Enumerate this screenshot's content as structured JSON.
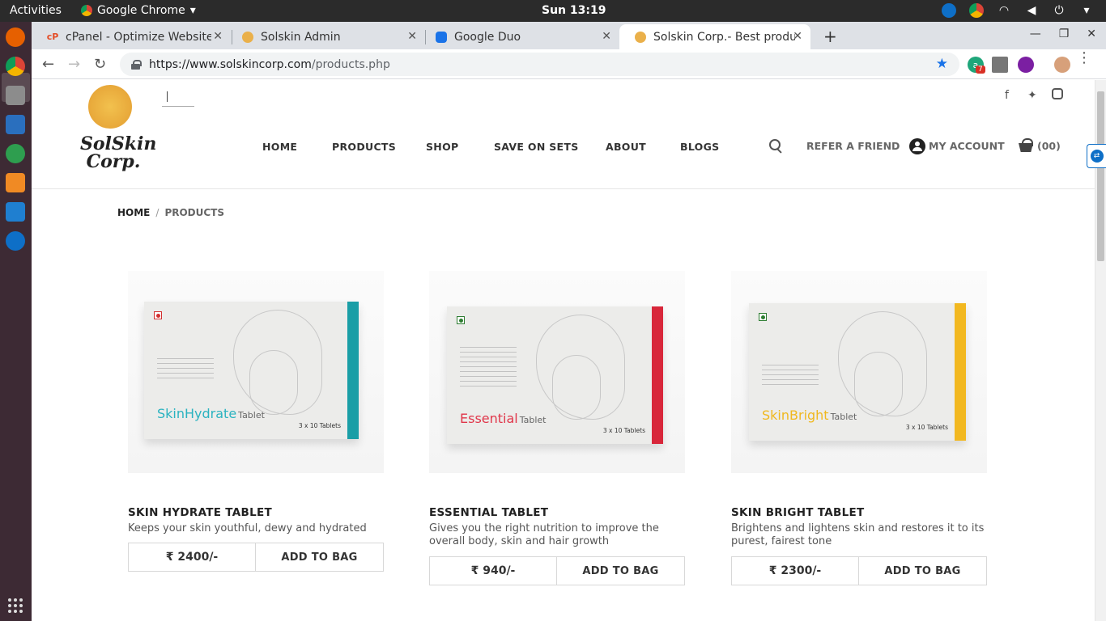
{
  "os": {
    "activities": "Activities",
    "app_name": "Google Chrome",
    "clock": "Sun 13:19"
  },
  "tabs": [
    {
      "title": "cPanel - Optimize Website"
    },
    {
      "title": "Solskin Admin"
    },
    {
      "title": "Google Duo"
    },
    {
      "title": "Solskin Corp.- Best products"
    }
  ],
  "address": {
    "domain": "https://www.solskincorp.com",
    "path": "/products.php"
  },
  "extension_badge": "7",
  "site": {
    "brand": "SolSkin Corp.",
    "nav": [
      "HOME",
      "PRODUCTS",
      "SHOP",
      "SAVE ON SETS",
      "ABOUT",
      "BLOGS"
    ],
    "refer": "REFER A FRIEND",
    "account": "MY ACCOUNT",
    "cart_count": "(00)",
    "breadcrumb": {
      "home": "HOME",
      "sep": "/",
      "current": "PRODUCTS"
    }
  },
  "products": [
    {
      "name": "SKIN HYDRATE TABLET",
      "desc": "Keeps your skin youthful, dewy and hydrated",
      "price": "₹ 2400/-",
      "button": "ADD TO BAG",
      "box_title": "SkinHydrate",
      "box_sub": "Tablet",
      "box_qty": "3 x 10 Tablets",
      "accent": "#1a9ea6",
      "title_color": "#2bb3c0",
      "mark_color": "#d32f2f"
    },
    {
      "name": "ESSENTIAL TABLET",
      "desc": "Gives you the right nutrition to improve the overall body, skin and hair growth",
      "price": "₹ 940/-",
      "button": "ADD TO BAG",
      "box_title": "Essential",
      "box_sub": "Tablet",
      "box_qty": "3 x 10 Tablets",
      "accent": "#d8263a",
      "title_color": "#e0364a",
      "mark_color": "#2e7d32"
    },
    {
      "name": "SKIN BRIGHT TABLET",
      "desc": "Brightens and lightens skin and restores it to its purest, fairest tone",
      "price": "₹ 2300/-",
      "button": "ADD TO BAG",
      "box_title": "SkinBright",
      "box_sub": "Tablet",
      "box_qty": "3 x 10 Tablets",
      "accent": "#f2b820",
      "title_color": "#f0b81e",
      "mark_color": "#2e7d32"
    }
  ]
}
